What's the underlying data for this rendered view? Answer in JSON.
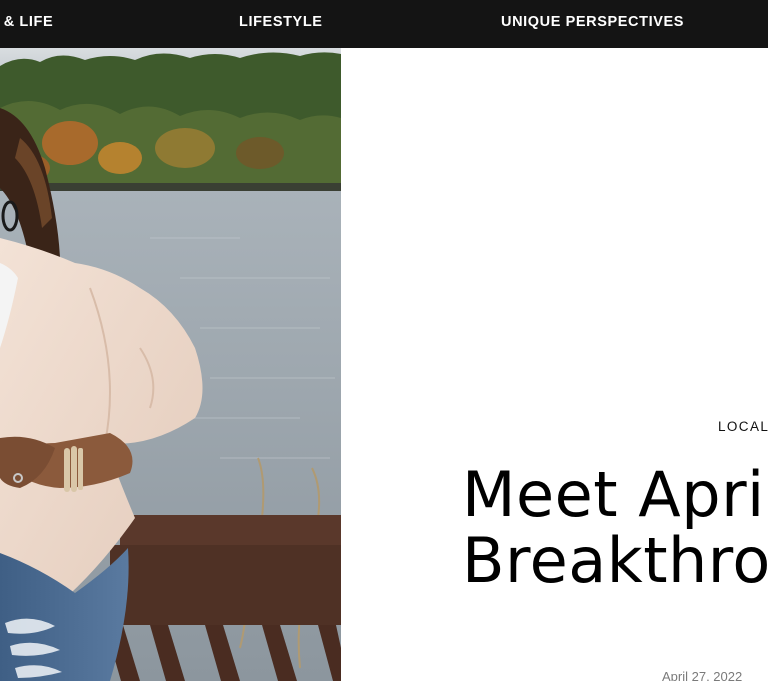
{
  "nav": {
    "items": [
      {
        "label": "K & LIFE"
      },
      {
        "label": "LIFESTYLE"
      },
      {
        "label": "UNIQUE PERSPECTIVES"
      }
    ]
  },
  "article": {
    "category": "LOCAL",
    "title_line1": "Meet April",
    "title_line2": "Breakthrough",
    "date": "April 27, 2022"
  },
  "colors": {
    "nav_bg": "#141414",
    "nav_text": "#ffffff",
    "page_bg": "#ffffff",
    "date_text": "#7a7a7a"
  }
}
